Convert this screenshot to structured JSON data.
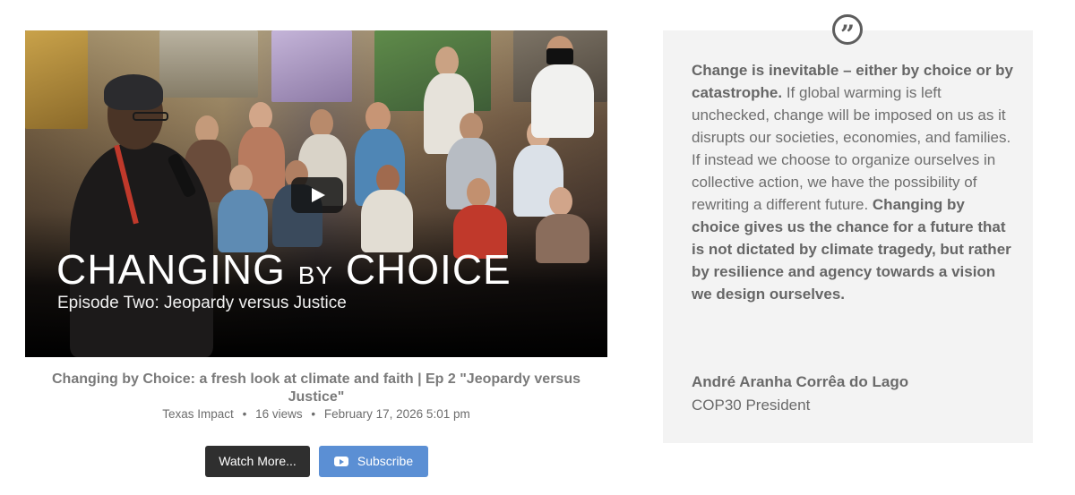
{
  "video": {
    "overlay_title_part1": "CHANGING",
    "overlay_title_part2": "BY",
    "overlay_title_part3": "CHOICE",
    "overlay_subtitle": "Episode Two: Jeopardy versus Justice",
    "title": "Changing by Choice: a fresh look at climate and faith | Ep 2 \"Jeopardy versus Justice\"",
    "channel": "Texas Impact",
    "views": "16 views",
    "date": "February 17, 2026 5:01 pm",
    "separator": "•"
  },
  "buttons": {
    "watch_more": "Watch More...",
    "subscribe": "Subscribe"
  },
  "quote": {
    "icon_glyph": "”",
    "bold_1": "Change is inevitable – either by choice or by catastrophe.",
    "text_1": " If global warming is left unchecked, change will be imposed on us as it disrupts our societies, economies, and families. If instead we choose to organize ourselves in collective action, we have the possibility of rewriting a different future. ",
    "bold_2": "Changing by choice gives us the chance for a future that is not dictated by climate tragedy, but rather by resilience and agency towards a vision we design ourselves.",
    "author": "André Aranha Corrêa do Lago",
    "role": "COP30 President"
  },
  "icons": {
    "play": "play-icon",
    "quote": "quote-icon",
    "youtube": "youtube-icon"
  },
  "colors": {
    "subscribe_bg": "#5b8fd4",
    "watch_bg": "#2f2f2f",
    "panel_bg": "#f3f3f3"
  }
}
